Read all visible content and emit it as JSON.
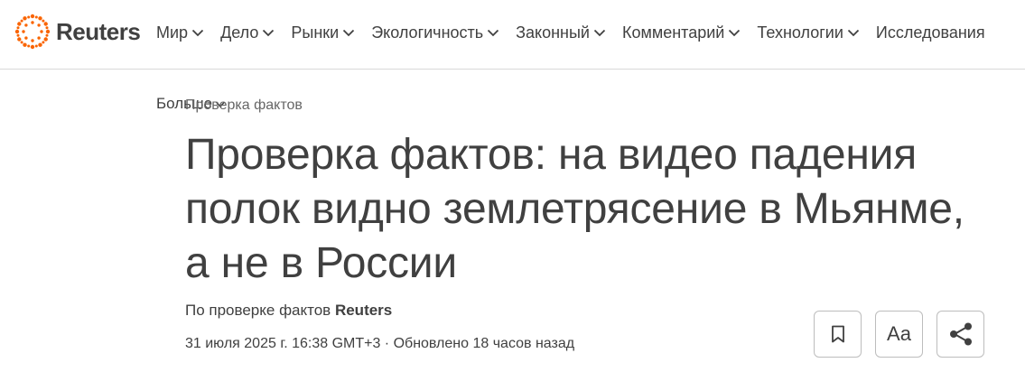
{
  "brand": {
    "name": "Reuters",
    "logo_color": "#fa6400"
  },
  "nav": {
    "items": [
      {
        "label": "Мир",
        "has_dropdown": true
      },
      {
        "label": "Дело",
        "has_dropdown": true
      },
      {
        "label": "Рынки",
        "has_dropdown": true
      },
      {
        "label": "Экологичность",
        "has_dropdown": true
      },
      {
        "label": "Законный",
        "has_dropdown": true
      },
      {
        "label": "Комментарий",
        "has_dropdown": true
      },
      {
        "label": "Технологии",
        "has_dropdown": true
      },
      {
        "label": "Исследования",
        "has_dropdown": false
      }
    ],
    "more_label": "Больше"
  },
  "article": {
    "kicker": "Проверка фактов",
    "headline": "Проверка фактов: на видео падения полок видно землетрясение в Мьянме, а не в России",
    "byline_prefix": "По проверке фактов",
    "byline_author": "Reuters",
    "dateline": "31 июля 2025 г. 16:38 GMT+3 · Обновлено 18 часов назад"
  },
  "tools": {
    "bookmark_icon": "bookmark-icon",
    "text_size_label": "Aa",
    "share_icon": "share-icon"
  }
}
